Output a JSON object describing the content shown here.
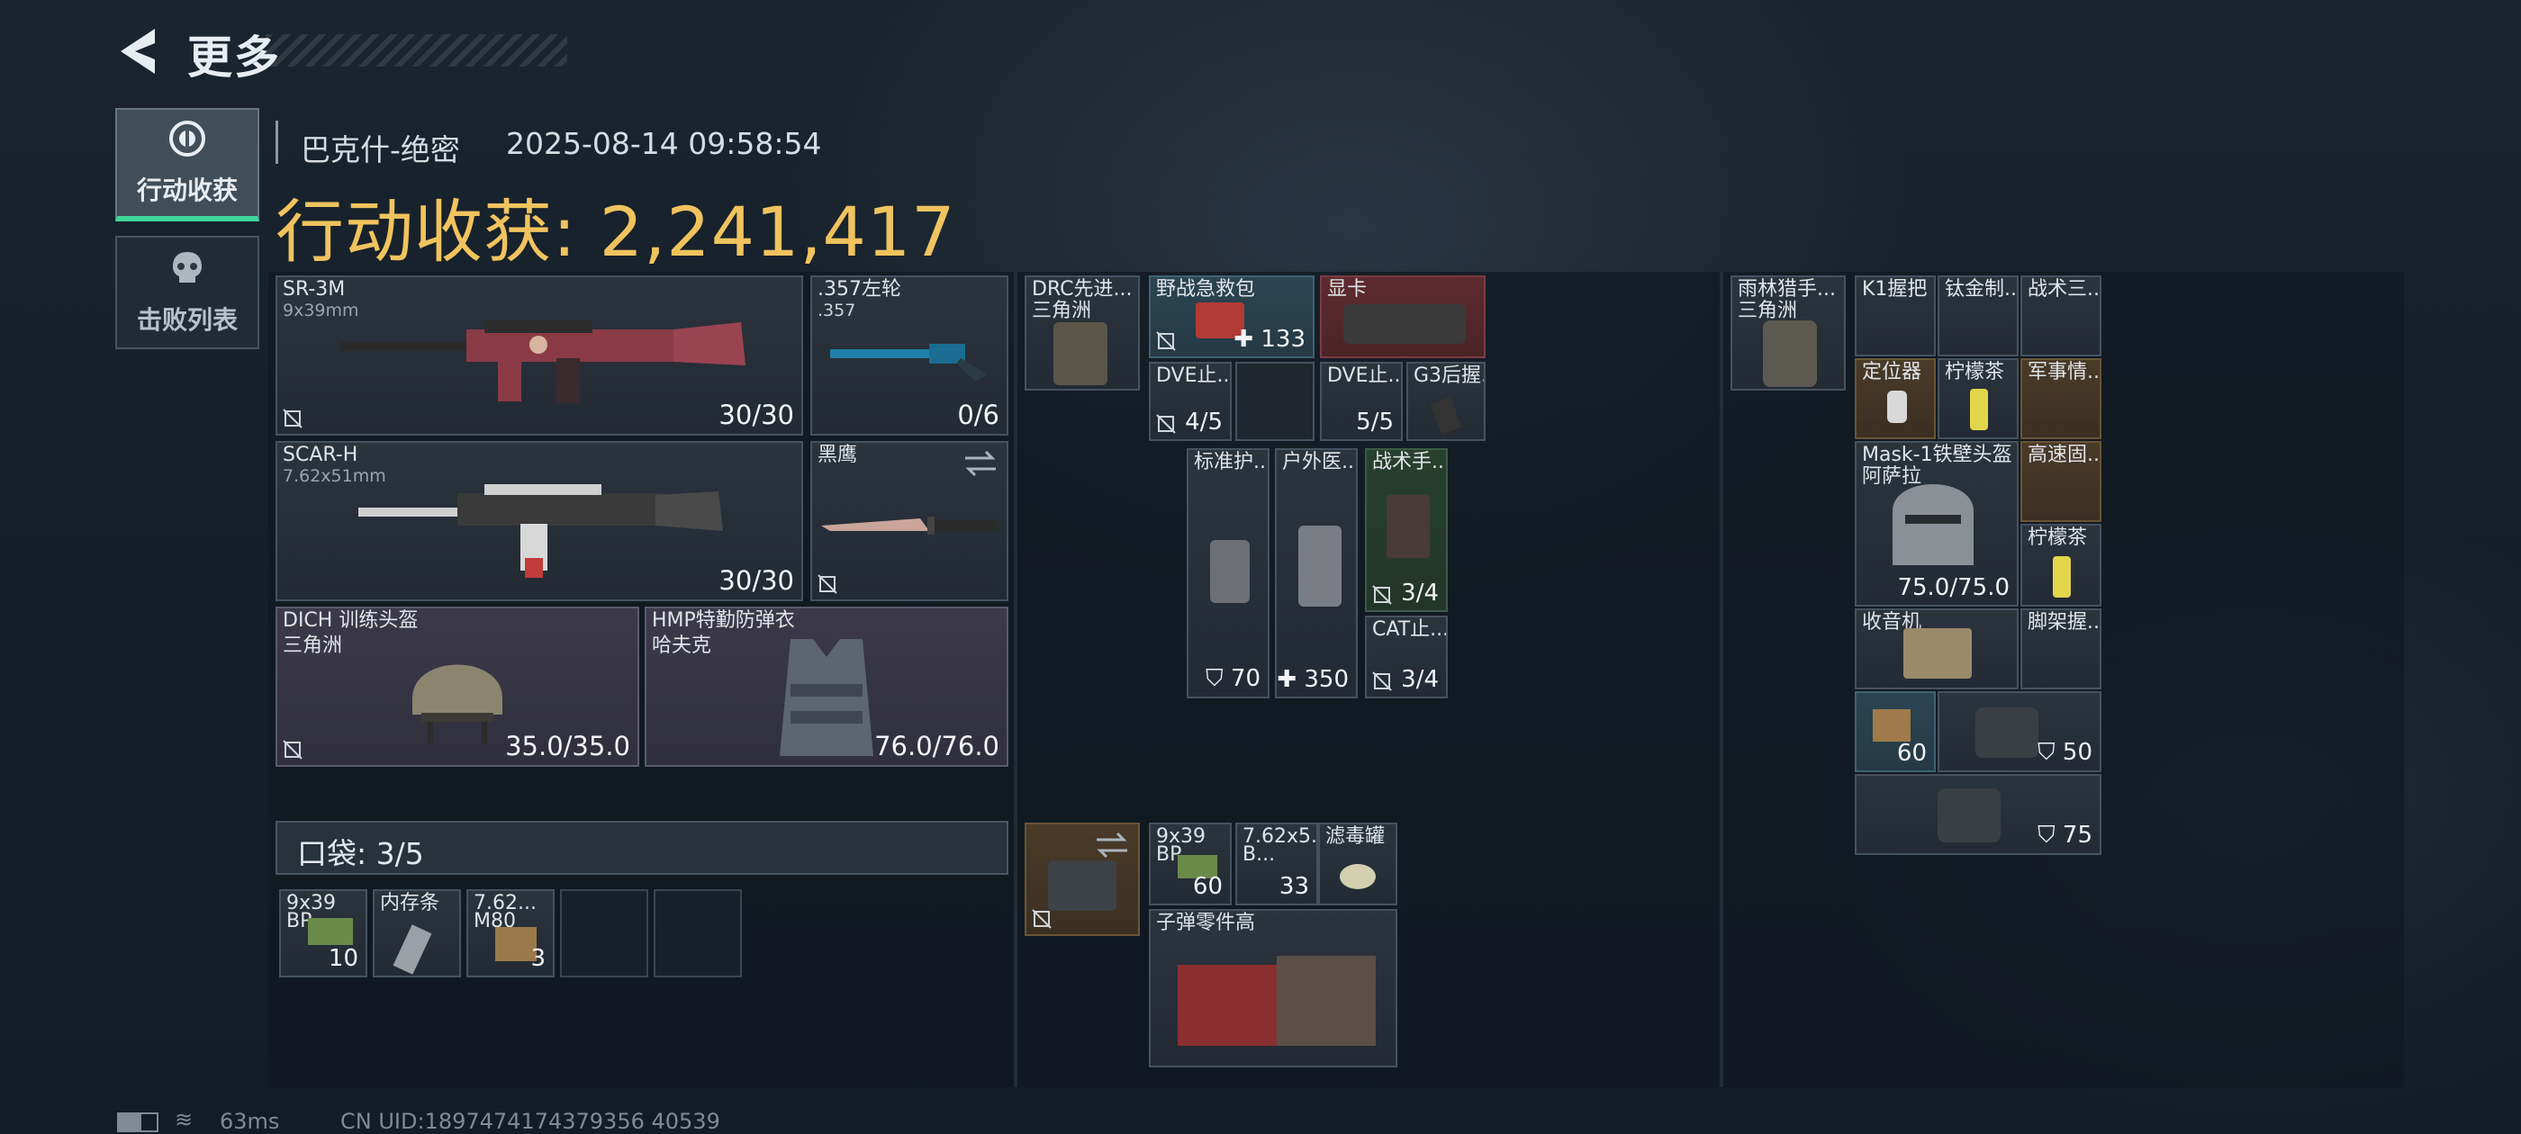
{
  "header": {
    "title": "更多"
  },
  "nav": {
    "tabs": [
      {
        "label": "行动收获",
        "icon": "loot-icon",
        "active": true
      },
      {
        "label": "击败列表",
        "icon": "skull-icon",
        "active": false
      }
    ]
  },
  "match": {
    "map": "巴克什-绝密",
    "time": "2025-08-14 09:58:54",
    "earnings_label": "行动收获: 2,241,417"
  },
  "equipment": {
    "primary1": {
      "name": "SR-3M",
      "caliber": "9x39mm",
      "ammo": "30/30"
    },
    "sidearm": {
      "name": ".357左轮",
      "caliber": ".357",
      "ammo": "0/6"
    },
    "primary2": {
      "name": "SCAR-H",
      "caliber": "7.62x51mm",
      "ammo": "30/30"
    },
    "melee": {
      "name": "黑鹰"
    },
    "helmet": {
      "name": "DICH 训练头盔",
      "brand": "三角洲",
      "durability": "35.0/35.0"
    },
    "armor": {
      "name": "HMP特勤防弹衣",
      "brand": "哈夫克",
      "durability": "76.0/76.0"
    }
  },
  "pocket": {
    "label": "口袋: 3/5",
    "items": [
      {
        "name": "9x39",
        "sub": "BP",
        "qty": "10"
      },
      {
        "name": "内存条",
        "qty": ""
      },
      {
        "name": "7.62...",
        "sub": "M80",
        "qty": "3"
      }
    ]
  },
  "chest_rig": {
    "name": "DRC先进...",
    "brand": "三角洲",
    "items": [
      {
        "name": "野战急救包",
        "qty": "133"
      },
      {
        "name": "显卡",
        "qty": ""
      },
      {
        "name": "DVE止...",
        "qty": "4/5"
      },
      {
        "name": "DVE止...",
        "qty": "5/5"
      },
      {
        "name": "G3后握...",
        "qty": ""
      },
      {
        "name": "标准护...",
        "qty": "70"
      },
      {
        "name": "户外医...",
        "qty": "350"
      },
      {
        "name": "战术手...",
        "qty": "3/4"
      },
      {
        "name": "CAT止...",
        "qty": "3/4"
      }
    ]
  },
  "bag_items": [
    {
      "name": "9x39",
      "sub": "BP",
      "qty": "60"
    },
    {
      "name": "7.62x5...",
      "sub": "B...",
      "qty": "33"
    },
    {
      "name": "滤毒罐",
      "qty": ""
    },
    {
      "name": "子弹零件高",
      "qty": ""
    }
  ],
  "backpack": {
    "name": "雨林猎手...",
    "brand": "三角洲",
    "items": [
      {
        "name": "K1握把",
        "qty": ""
      },
      {
        "name": "钛金制...",
        "qty": ""
      },
      {
        "name": "战术三...",
        "qty": ""
      },
      {
        "name": "定位器",
        "qty": ""
      },
      {
        "name": "柠檬茶",
        "qty": ""
      },
      {
        "name": "军事情...",
        "qty": ""
      },
      {
        "name": "Mask-1铁壁头盔",
        "sub": "阿萨拉",
        "qty": "75.0/75.0"
      },
      {
        "name": "高速固...",
        "qty": ""
      },
      {
        "name": "柠檬茶",
        "qty": ""
      },
      {
        "name": "收音机",
        "qty": ""
      },
      {
        "name": "脚架握...",
        "qty": ""
      },
      {
        "name": "",
        "qty": "60"
      },
      {
        "name": "",
        "qty": "50"
      },
      {
        "name": "",
        "qty": "75"
      }
    ]
  },
  "status_bar": {
    "ping": "63ms",
    "uid": "CN UID:1897474174379356 40539"
  }
}
